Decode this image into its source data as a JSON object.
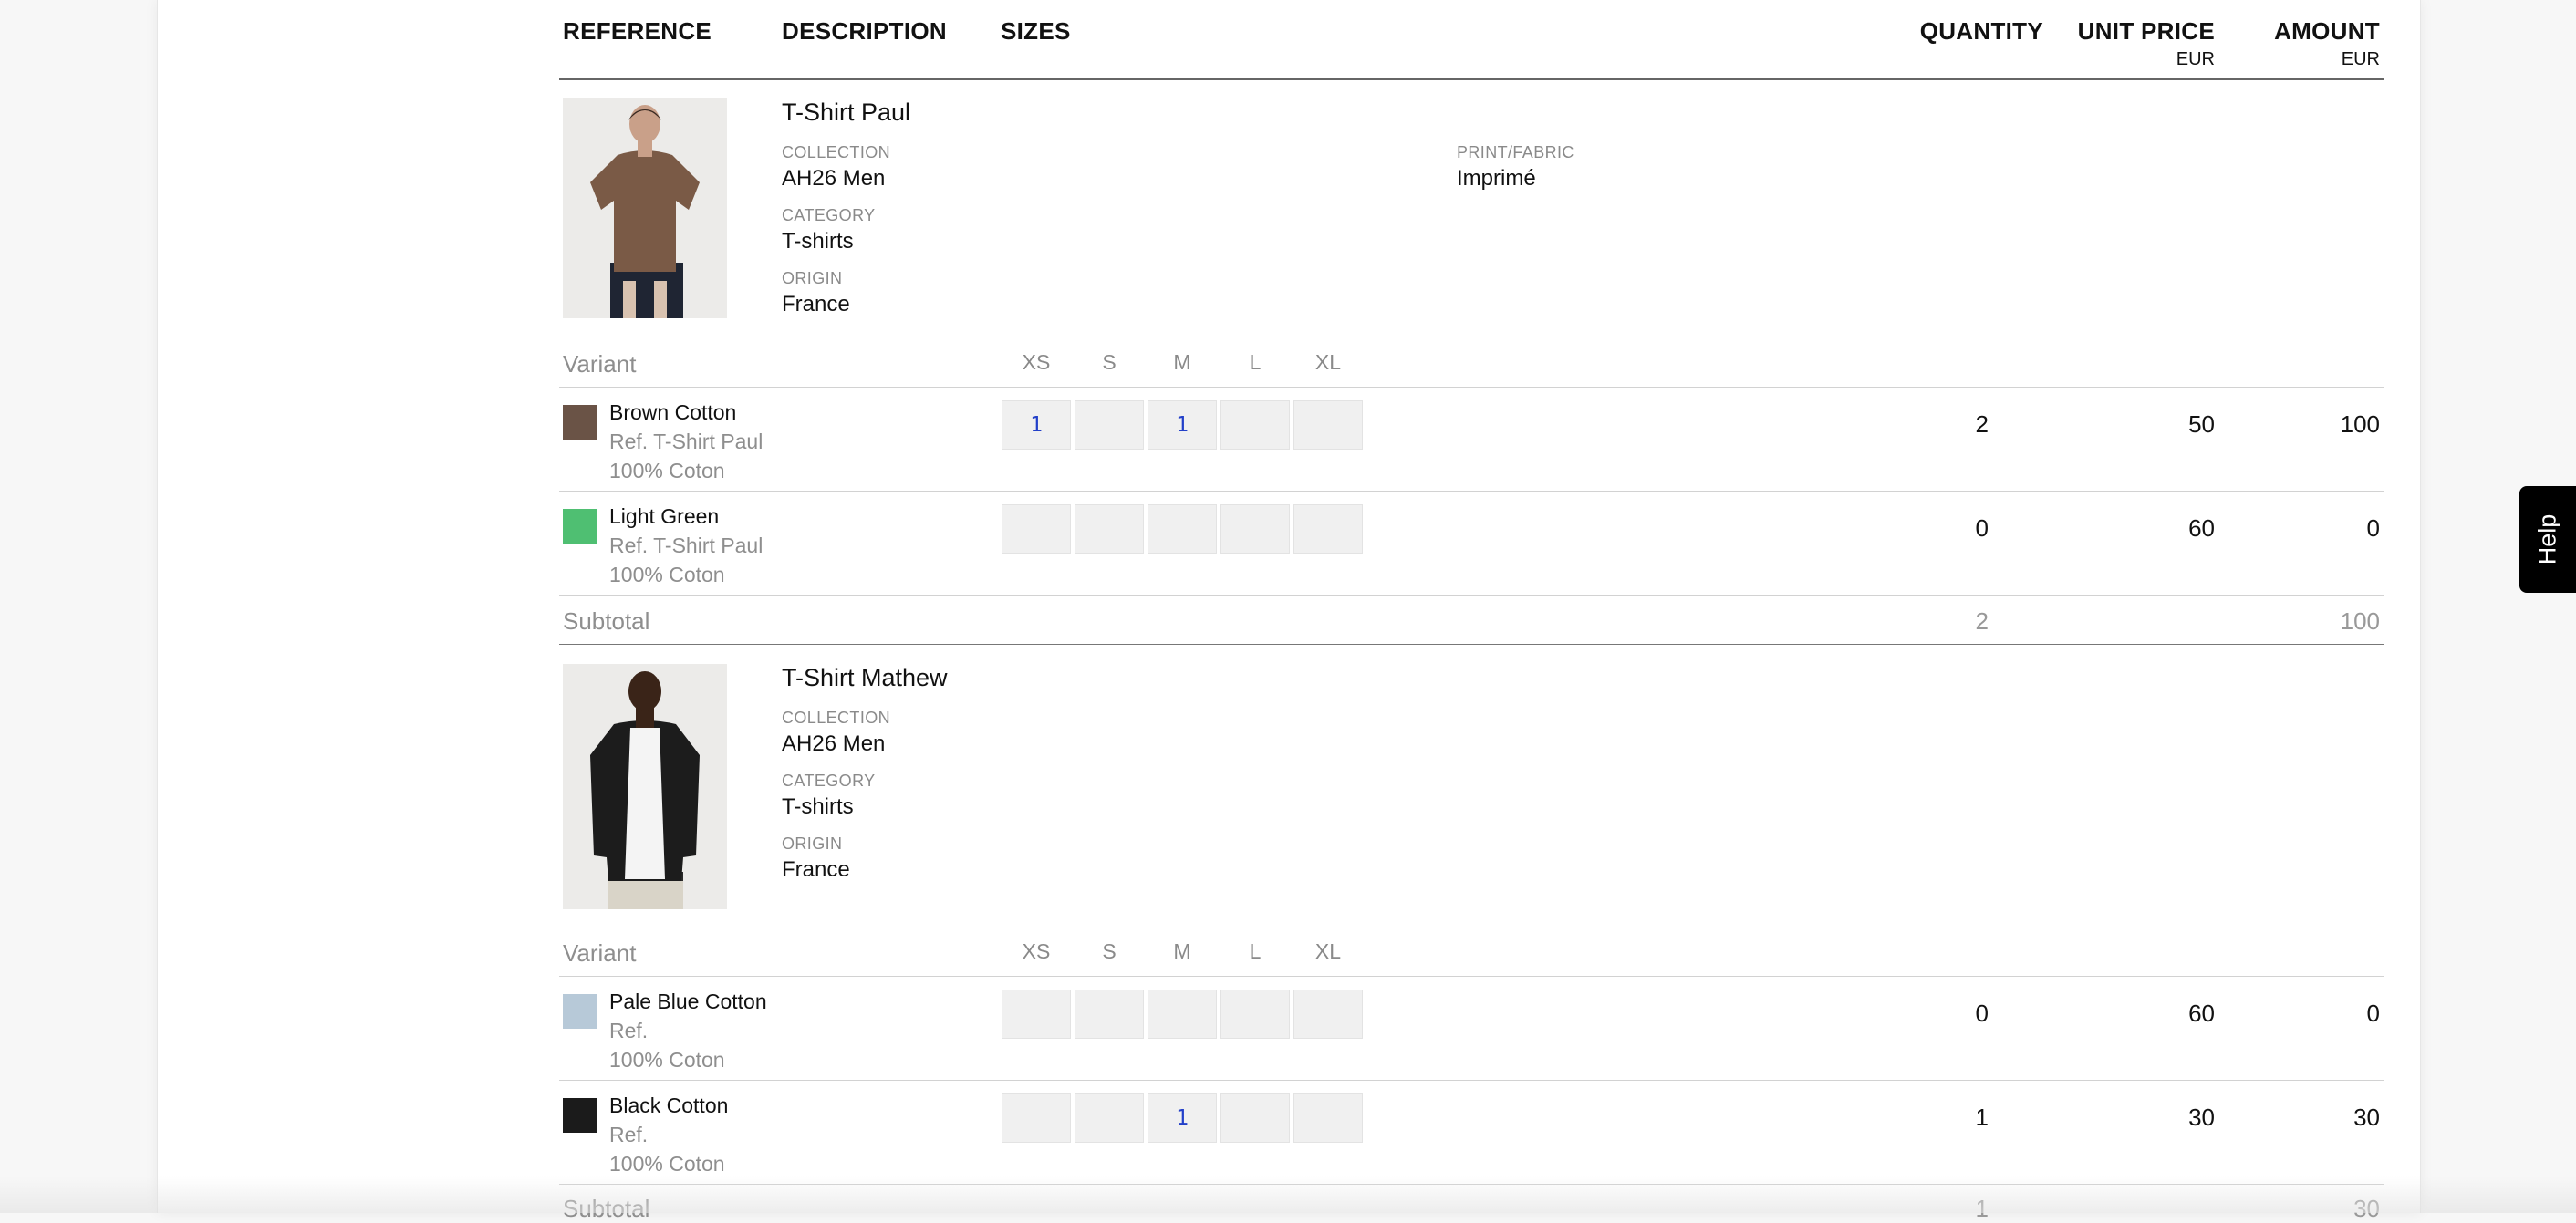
{
  "table_header": {
    "reference": "REFERENCE",
    "description": "DESCRIPTION",
    "sizes": "SIZES",
    "quantity": "QUANTITY",
    "unit_price": "UNIT PRICE",
    "unit_price_currency": "EUR",
    "amount": "AMOUNT",
    "amount_currency": "EUR"
  },
  "products": [
    {
      "title": "T-Shirt Paul",
      "collection_label": "COLLECTION",
      "collection": "AH26 Men",
      "category_label": "CATEGORY",
      "category": "T-shirts",
      "origin_label": "ORIGIN",
      "origin": "France",
      "print_label": "PRINT/FABRIC",
      "print": "Imprimé",
      "variant_label": "Variant",
      "sizes": [
        "XS",
        "S",
        "M",
        "L",
        "XL"
      ],
      "variants": [
        {
          "name": "Brown Cotton",
          "ref": "Ref. T-Shirt Paul",
          "composition": "100% Coton",
          "swatch_color": "#6a5346",
          "qty_by_size": [
            "1",
            "",
            "1",
            "",
            ""
          ],
          "quantity": "2",
          "unit_price": "50",
          "amount": "100"
        },
        {
          "name": "Light Green",
          "ref": "Ref. T-Shirt Paul",
          "composition": "100% Coton",
          "swatch_color": "#4fbf72",
          "qty_by_size": [
            "",
            "",
            "",
            "",
            ""
          ],
          "quantity": "0",
          "unit_price": "60",
          "amount": "0"
        }
      ],
      "subtotal_label": "Subtotal",
      "subtotal_quantity": "2",
      "subtotal_amount": "100"
    },
    {
      "title": "T-Shirt Mathew",
      "collection_label": "COLLECTION",
      "collection": "AH26 Men",
      "category_label": "CATEGORY",
      "category": "T-shirts",
      "origin_label": "ORIGIN",
      "origin": "France",
      "variant_label": "Variant",
      "sizes": [
        "XS",
        "S",
        "M",
        "L",
        "XL"
      ],
      "variants": [
        {
          "name": "Pale Blue Cotton",
          "ref": "Ref.",
          "composition": "100% Coton",
          "swatch_color": "#b7c9d8",
          "qty_by_size": [
            "",
            "",
            "",
            "",
            ""
          ],
          "quantity": "0",
          "unit_price": "60",
          "amount": "0"
        },
        {
          "name": "Black Cotton",
          "ref": "Ref.",
          "composition": "100% Coton",
          "swatch_color": "#1b1b1b",
          "qty_by_size": [
            "",
            "",
            "1",
            "",
            ""
          ],
          "quantity": "1",
          "unit_price": "30",
          "amount": "30"
        }
      ],
      "subtotal_label": "Subtotal",
      "subtotal_quantity": "1",
      "subtotal_amount": "30"
    }
  ],
  "help_button": {
    "label": "Help"
  }
}
